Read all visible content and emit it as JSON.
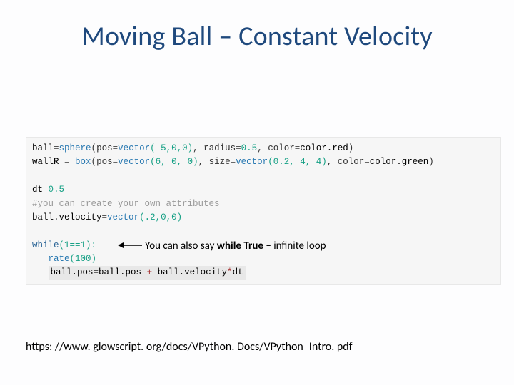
{
  "title": "Moving Ball – Constant Velocity",
  "code": {
    "line1_prefix": "ball",
    "line1_eq": "=",
    "line1_func": "sphere",
    "line1_open": "(",
    "line1_arg1_name": "pos",
    "line1_arg1_eq": "=",
    "line1_arg1_func": "vector",
    "line1_arg1_vals": "(-5,0,0)",
    "line1_comma1": ", ",
    "line1_arg2_name": "radius",
    "line1_arg2_eq": "=",
    "line1_arg2_val": "0.5",
    "line1_comma2": ", ",
    "line1_arg3_name": "color",
    "line1_arg3_eq": "=",
    "line1_arg3_val": "color.red",
    "line1_close": ")",
    "line2_prefix": "wallR ",
    "line2_eq": "=",
    "line2_func": " box",
    "line2_open": "(",
    "line2_arg1_name": "pos",
    "line2_arg1_eq": "=",
    "line2_arg1_func": "vector",
    "line2_arg1_vals": "(6, 0, 0)",
    "line2_comma1": ", ",
    "line2_arg2_name": "size",
    "line2_arg2_eq": "=",
    "line2_arg2_func": "vector",
    "line2_arg2_vals": "(0.2, 4, 4)",
    "line2_comma2": ", ",
    "line2_arg3_name": "color",
    "line2_arg3_eq": "=",
    "line2_arg3_val": "color.green",
    "line2_close": ")",
    "line3_blank": " ",
    "line4": "dt=0.5",
    "line4_prefix": "dt",
    "line4_eq": "=",
    "line4_val": "0.5",
    "line5": "#you can create your own attributes",
    "line6_prefix": "ball.velocity",
    "line6_eq": "=",
    "line6_func": "vector",
    "line6_vals": "(.2,0,0)",
    "line7_blank": " ",
    "line8_kw": "while",
    "line8_cond": "(1==1): ",
    "line9_indent": "   ",
    "line9_func": "rate",
    "line9_arg": "(100)",
    "line10_indent": "   ",
    "line10_lhs": "ball.pos",
    "line10_eq": "=",
    "line10_rhs_a": "ball.pos ",
    "line10_plus": "+",
    "line10_rhs_b": " ball.velocity",
    "line10_mul": "*",
    "line10_rhs_c": "dt"
  },
  "annotation": {
    "text_before": "You can also say ",
    "text_bold": "while True",
    "text_after": " – infinite loop"
  },
  "footer": "https: //www. glowscript. org/docs/VPython. Docs/VPython_Intro. pdf"
}
